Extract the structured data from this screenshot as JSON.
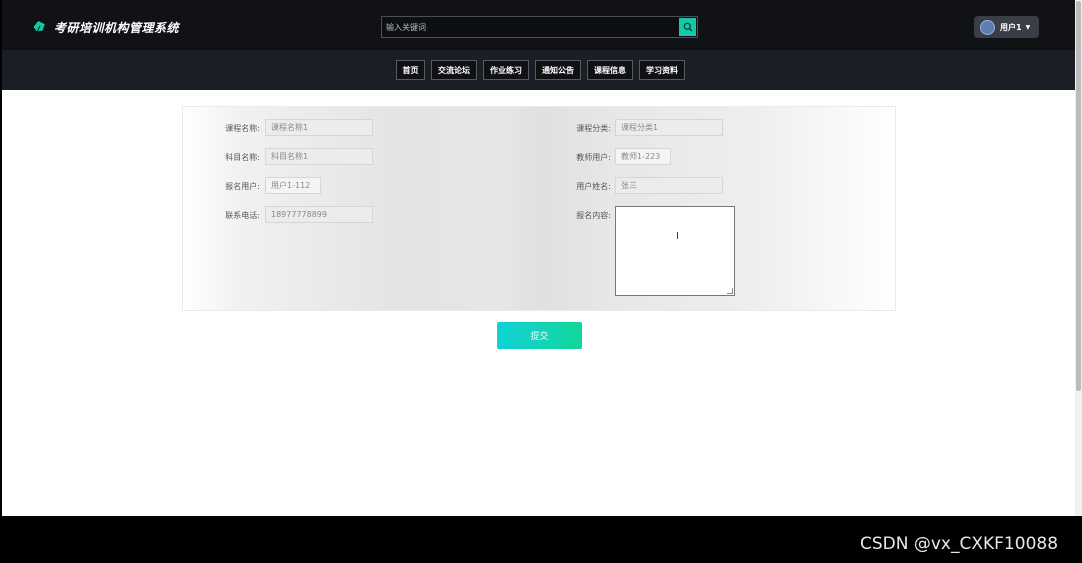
{
  "header": {
    "brand_title": "考研培训机构管理系统",
    "search_placeholder": "输入关键词",
    "search_icon": "search-icon",
    "user_name": "用户1",
    "accent_color": "#16c9a6"
  },
  "nav": {
    "items": [
      "首页",
      "交流论坛",
      "作业练习",
      "通知公告",
      "课程信息",
      "学习资料"
    ]
  },
  "form": {
    "course_name_label": "课程名称:",
    "course_name_value": "课程名称1",
    "subject_name_label": "科目名称:",
    "subject_name_value": "科目名称1",
    "enroll_user_label": "报名用户:",
    "enroll_user_value": "用户1-112",
    "phone_label": "联系电话:",
    "phone_value": "18977778899",
    "course_category_label": "课程分类:",
    "course_category_value": "课程分类1",
    "teacher_user_label": "教师用户:",
    "teacher_user_value": "教师1-223",
    "user_fullname_label": "用户姓名:",
    "user_fullname_value": "张三",
    "enroll_content_label": "报名内容:",
    "enroll_content_value": "",
    "submit_label": "提交"
  },
  "watermark": "CSDN @vx_CXKF10088"
}
